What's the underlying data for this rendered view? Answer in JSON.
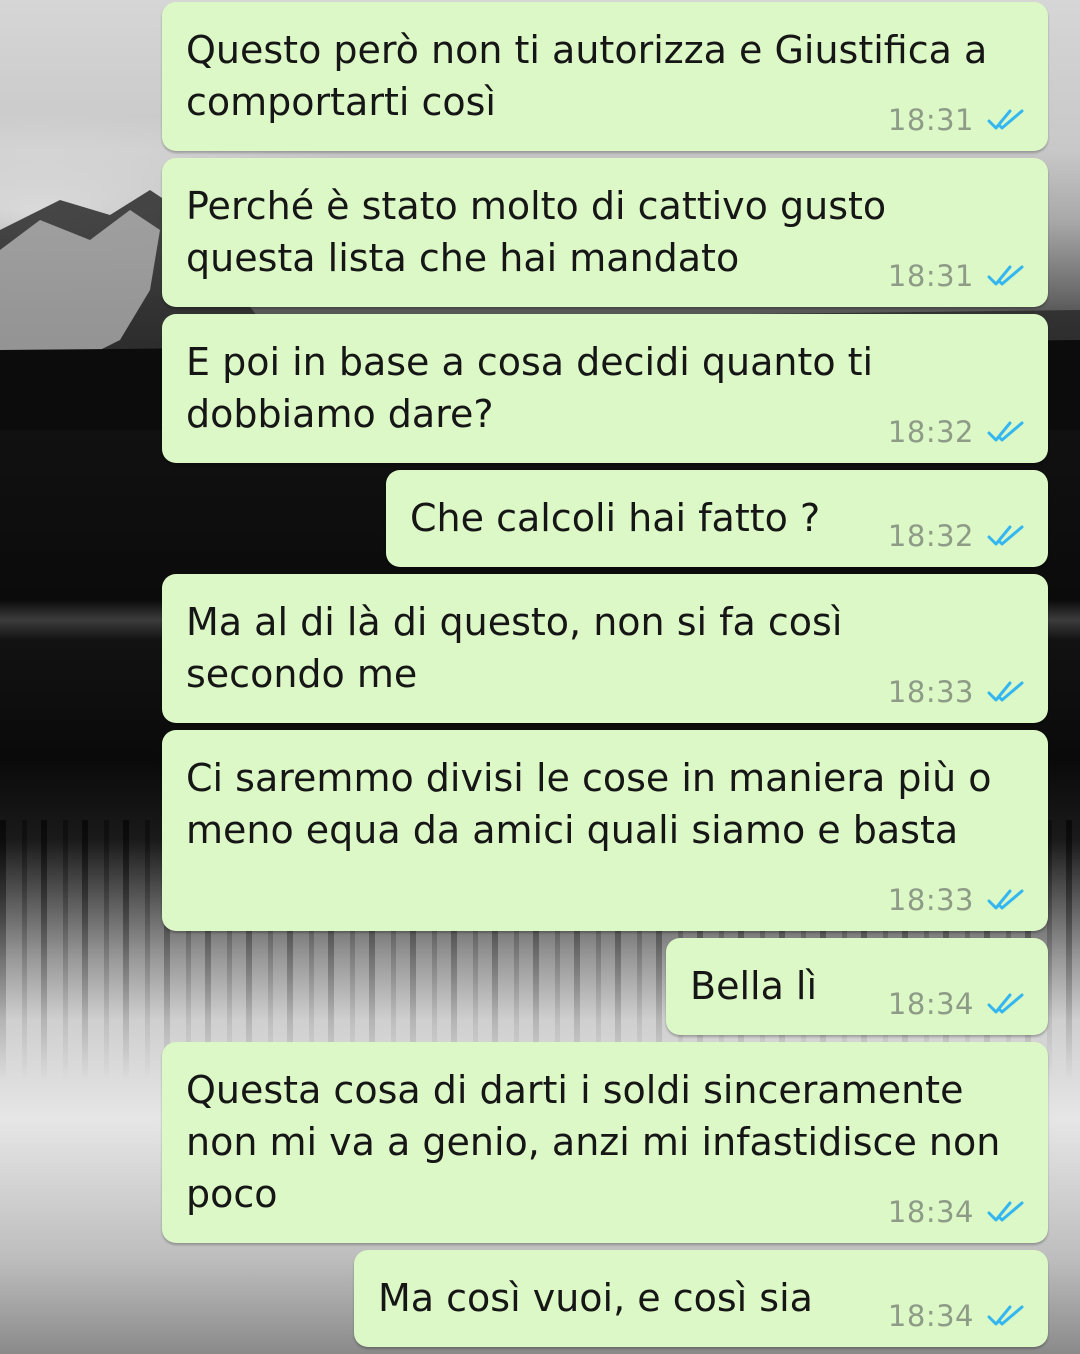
{
  "colors": {
    "bubble_outgoing": "#dcf8c6",
    "timestamp": "#8e9b87",
    "read_ticks": "#34b7f1"
  },
  "messages": [
    {
      "text": "Questo però non ti autorizza e Giustifica a\ncomportarti così",
      "time": "18:31",
      "status_icon": "double-check-read-icon"
    },
    {
      "text": "Perché è stato molto di cattivo gusto\nquesta lista che hai mandato",
      "time": "18:31",
      "status_icon": "double-check-read-icon"
    },
    {
      "text": "E poi in base a cosa decidi quanto ti\ndobbiamo dare?",
      "time": "18:32",
      "status_icon": "double-check-read-icon"
    },
    {
      "text": "Che calcoli hai fatto ?",
      "time": "18:32",
      "status_icon": "double-check-read-icon"
    },
    {
      "text": "Ma al di là di questo, non si fa così\nsecondo me",
      "time": "18:33",
      "status_icon": "double-check-read-icon"
    },
    {
      "text": "Ci saremmo divisi le cose in maniera più o\nmeno equa da amici quali siamo e basta",
      "time": "18:33",
      "status_icon": "double-check-read-icon"
    },
    {
      "text": "Bella lì",
      "time": "18:34",
      "status_icon": "double-check-read-icon"
    },
    {
      "text": "Questa cosa di darti i soldi sinceramente\nnon mi va a genio, anzi mi infastidisce non\npoco",
      "time": "18:34",
      "status_icon": "double-check-read-icon"
    },
    {
      "text": "Ma così vuoi, e così sia",
      "time": "18:34",
      "status_icon": "double-check-read-icon"
    }
  ]
}
